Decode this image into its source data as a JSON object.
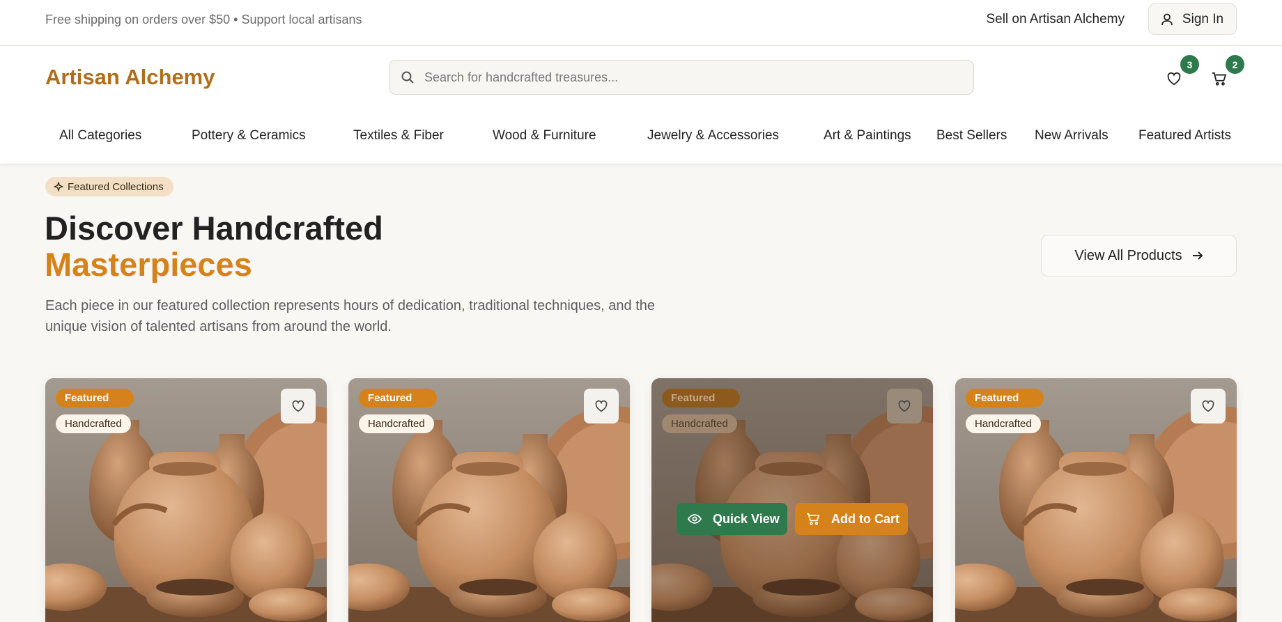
{
  "topbar": {
    "promo": "Free shipping on orders over $50 • Support local artisans",
    "sell_link": "Sell on Artisan Alchemy",
    "signin_label": "Sign In"
  },
  "header": {
    "logo": "Artisan Alchemy",
    "search_placeholder": "Search for handcrafted treasures...",
    "wishlist_count": "3",
    "cart_count": "2"
  },
  "nav": {
    "items": [
      "All Categories",
      "Pottery & Ceramics",
      "Textiles & Fiber",
      "Wood & Furniture",
      "Jewelry & Accessories",
      "Art & Paintings",
      "Best Sellers",
      "New Arrivals",
      "Featured Artists"
    ]
  },
  "hero": {
    "pill": "Featured Collections",
    "title_line1": "Discover Handcrafted",
    "title_line2": "Masterpieces",
    "description": "Each piece in our featured collection represents hours of dedication, traditional techniques, and the unique vision of talented artisans from around the world.",
    "view_all": "View All Products"
  },
  "cards": [
    {
      "tag_featured": "Featured",
      "tag_craft": "Handcrafted"
    },
    {
      "tag_featured": "Featured",
      "tag_craft": "Handcrafted"
    },
    {
      "tag_featured": "Featured",
      "tag_craft": "Handcrafted",
      "quick_view": "Quick View",
      "add_to_cart": "Add to Cart"
    },
    {
      "tag_featured": "Featured",
      "tag_craft": "Handcrafted"
    }
  ],
  "colors": {
    "brand": "#b06e1c",
    "accent": "#d6821a",
    "green": "#2f7a4d"
  }
}
